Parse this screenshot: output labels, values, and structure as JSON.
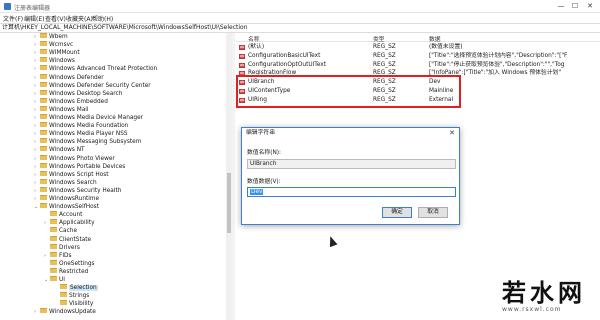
{
  "window": {
    "title": "注册表编辑器",
    "controls": [
      "—",
      "☐",
      "✕"
    ]
  },
  "menu": [
    "文件(F)",
    "编辑(E)",
    "查看(V)",
    "收藏夹(A)",
    "帮助(H)"
  ],
  "address": "计算机\\HKEY_LOCAL_MACHINE\\SOFTWARE\\Microsoft\\WindowsSelfHost\\UI\\Selection",
  "tree": [
    {
      "label": "Wbem",
      "exp": "›"
    },
    {
      "label": "Wcmsvc",
      "exp": "›"
    },
    {
      "label": "WIMMount",
      "exp": "›"
    },
    {
      "label": "Windows",
      "exp": "›"
    },
    {
      "label": "Windows Advanced Threat Protection",
      "exp": "›"
    },
    {
      "label": "Windows Defender",
      "exp": "›"
    },
    {
      "label": "Windows Defender Security Center",
      "exp": "›"
    },
    {
      "label": "Windows Desktop Search",
      "exp": "›"
    },
    {
      "label": "Windows Embedded",
      "exp": "›"
    },
    {
      "label": "Windows Mail",
      "exp": "›"
    },
    {
      "label": "Windows Media Device Manager",
      "exp": "›"
    },
    {
      "label": "Windows Media Foundation",
      "exp": "›"
    },
    {
      "label": "Windows Media Player NSS",
      "exp": "›"
    },
    {
      "label": "Windows Messaging Subsystem",
      "exp": "›"
    },
    {
      "label": "Windows NT",
      "exp": "›"
    },
    {
      "label": "Windows Photo Viewer",
      "exp": "›"
    },
    {
      "label": "Windows Portable Devices",
      "exp": "›"
    },
    {
      "label": "Windows Script Host",
      "exp": "›"
    },
    {
      "label": "Windows Search",
      "exp": "›"
    },
    {
      "label": "Windows Security Health",
      "exp": "›"
    },
    {
      "label": "WindowsRuntime",
      "exp": "›"
    },
    {
      "label": "WindowsSelfHost",
      "exp": "⌄"
    },
    {
      "label": "Account",
      "exp": ""
    },
    {
      "label": "Applicability",
      "exp": "›"
    },
    {
      "label": "Cache",
      "exp": ""
    },
    {
      "label": "ClientState",
      "exp": ""
    },
    {
      "label": "Drivers",
      "exp": ""
    },
    {
      "label": "FIDs",
      "exp": "›"
    },
    {
      "label": "OneSettings",
      "exp": ""
    },
    {
      "label": "Restricted",
      "exp": ""
    },
    {
      "label": "UI",
      "exp": "⌄"
    },
    {
      "label": "Selection",
      "exp": ""
    },
    {
      "label": "Strings",
      "exp": ""
    },
    {
      "label": "Visibility",
      "exp": ""
    },
    {
      "label": "WindowsUpdate",
      "exp": "›"
    }
  ],
  "list_header": {
    "name": "名称",
    "type": "类型",
    "data": "数据"
  },
  "list_rows": [
    {
      "name": "(默认)",
      "type": "REG_SZ",
      "data": "(数值未设置)"
    },
    {
      "name": "ConfigurationBasicUIText",
      "type": "REG_SZ",
      "data": "[\"Title\":\"选择预览体验计划内容\",\"Description\":\"[\"F"
    },
    {
      "name": "ConfigurationOptOutUIText",
      "type": "REG_SZ",
      "data": "[\"Title\":\"停止获取预览体验\",\"Description\":\"\",\"Tog"
    },
    {
      "name": "RegistrationFlow",
      "type": "REG_SZ",
      "data": "[\"InfoPane\":[\"Title\":\"加入 Windows 预体验计划\""
    },
    {
      "name": "UIBranch",
      "type": "REG_SZ",
      "data": "Dev"
    },
    {
      "name": "UIContentType",
      "type": "REG_SZ",
      "data": "Mainline"
    },
    {
      "name": "UIRing",
      "type": "REG_SZ",
      "data": "External"
    }
  ],
  "dialog": {
    "title": "编辑字符串",
    "value_name_label": "数值名称(N):",
    "value_name": "UIBranch",
    "value_data_label": "数值数据(V):",
    "value_data": "Dev",
    "ok_label": "确定",
    "cancel_label": "取消"
  },
  "watermark": {
    "text": "若水网",
    "url": "www.rsxwl.com"
  }
}
